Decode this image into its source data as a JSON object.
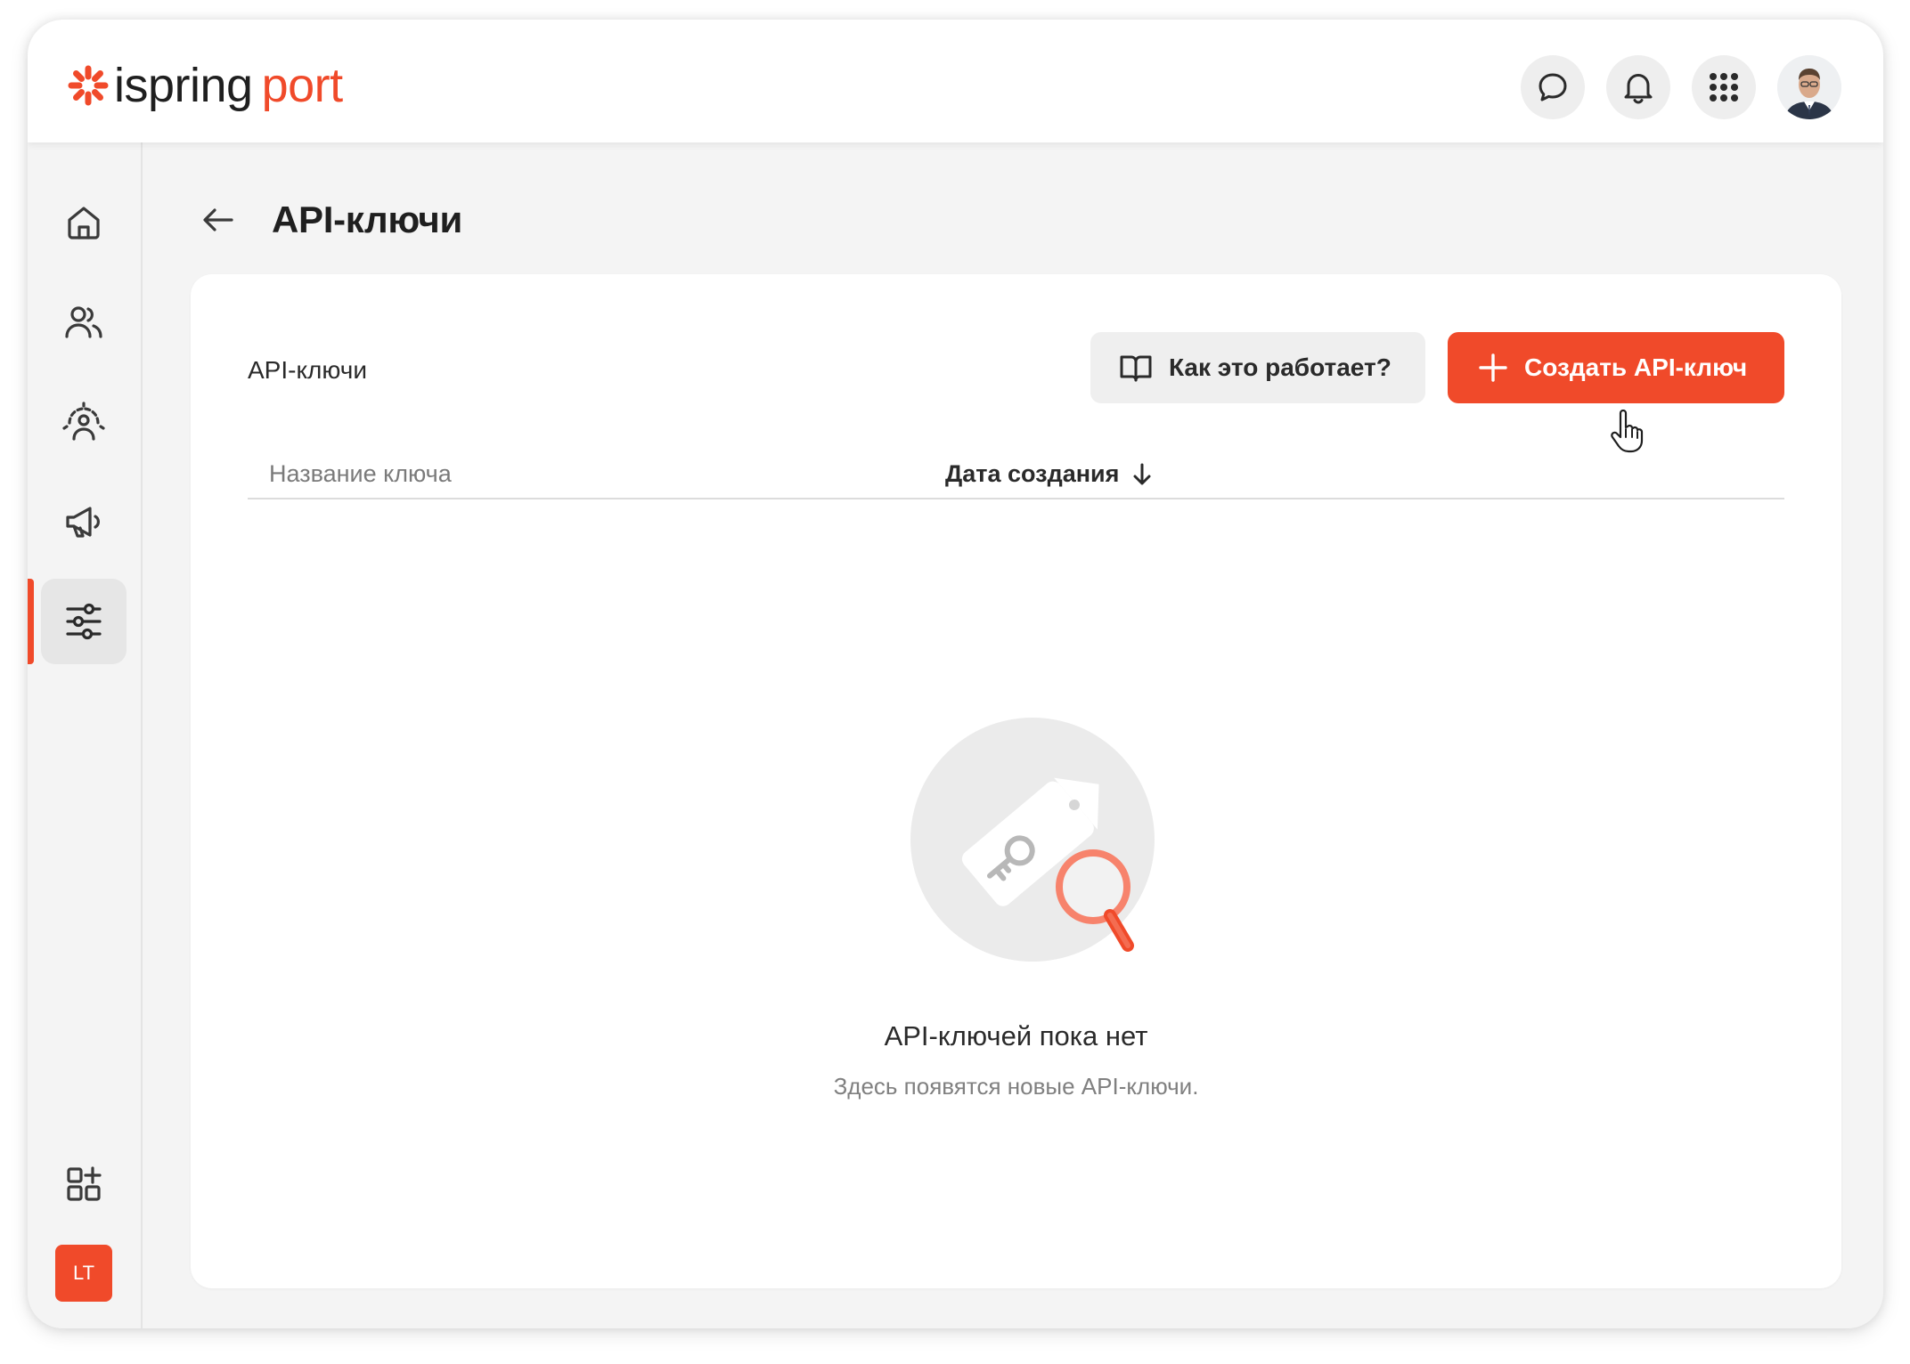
{
  "brand": {
    "name_part1": "ispring",
    "name_part2": "port",
    "accent": "#f04a2a"
  },
  "topbar": {
    "icons": [
      "chat-icon",
      "bell-icon",
      "apps-grid-icon"
    ],
    "avatar": "user-avatar"
  },
  "sidebar": {
    "items": [
      {
        "icon": "home-icon",
        "active": false
      },
      {
        "icon": "users-icon",
        "active": false
      },
      {
        "icon": "user-settings-icon",
        "active": false
      },
      {
        "icon": "megaphone-icon",
        "active": false
      },
      {
        "icon": "sliders-icon",
        "active": true
      }
    ],
    "bottom_icon": "add-widget-icon",
    "badge_label": "LT"
  },
  "page": {
    "title": "API-ключи",
    "back_icon": "arrow-left-icon"
  },
  "card": {
    "label": "API-ключи",
    "how_button_label": "Как это работает?",
    "create_button_label": "Создать API-ключ"
  },
  "table": {
    "columns": [
      "Название ключа",
      "Дата создания"
    ],
    "sort_icon": "arrow-down-icon"
  },
  "empty_state": {
    "title": "API-ключей пока нет",
    "subtitle": "Здесь появятся новые API-ключи."
  }
}
